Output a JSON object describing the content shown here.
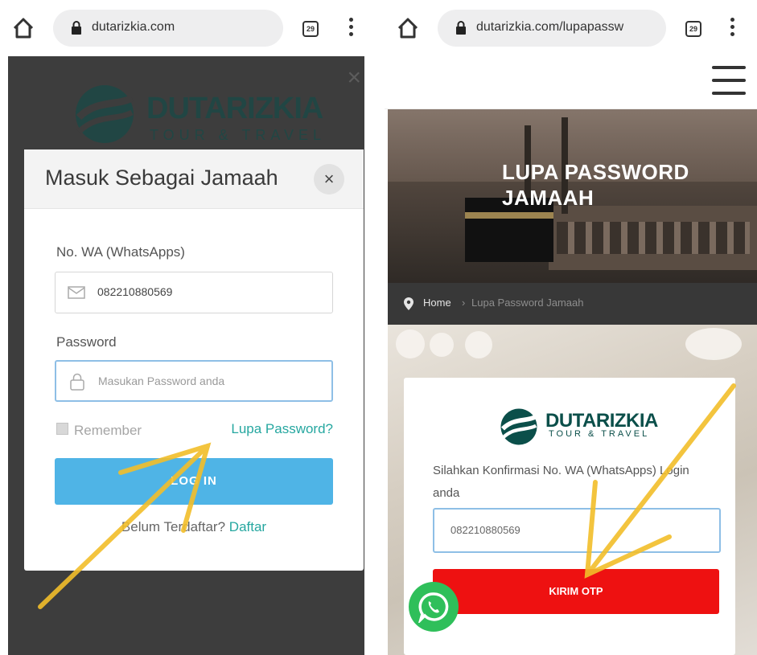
{
  "left_screen": {
    "browser": {
      "url": "dutarizkia.com",
      "tab_count": "29"
    },
    "background_logo": {
      "name": "DUTARIZKIA",
      "tagline": "TOUR & TRAVEL"
    },
    "modal": {
      "title": "Masuk Sebagai Jamaah",
      "close_symbol": "×",
      "wa_label": "No. WA (WhatsApps)",
      "wa_value": "082210880569",
      "password_label": "Password",
      "password_placeholder": "Masukan Password anda",
      "remember_label": "Remember",
      "forgot_link": "Lupa Password?",
      "login_button": "LOG IN",
      "register_prompt": "Belum Terdaftar?",
      "register_link": "Daftar"
    }
  },
  "right_screen": {
    "browser": {
      "url": "dutarizkia.com/lupapassw",
      "tab_count": "29"
    },
    "hero": {
      "title_line1": "LUPA PASSWORD",
      "title_line2": "JAMAAH"
    },
    "breadcrumb": {
      "home": "Home",
      "separator": "›",
      "current": "Lupa Password Jamaah"
    },
    "card": {
      "logo_name": "DUTARIZKIA",
      "logo_tagline": "TOUR & TRAVEL",
      "instruction": "Silahkan Konfirmasi No. WA (WhatsApps) Login anda",
      "wa_value": "082210880569",
      "submit_button": "KIRIM OTP"
    }
  },
  "colors": {
    "teal_link": "#26a7a0",
    "login_blue": "#4fb4e6",
    "otp_red": "#ee1111",
    "whatsapp_green": "#2fbf5a",
    "arrow_yellow": "#f2be2a",
    "brand_dark_teal": "#0b4f4a"
  },
  "icons": [
    "home-icon",
    "lock-icon",
    "menu-dots-icon",
    "hamburger-icon",
    "envelope-icon",
    "padlock-icon",
    "location-pin-icon",
    "whatsapp-icon",
    "close-icon"
  ]
}
